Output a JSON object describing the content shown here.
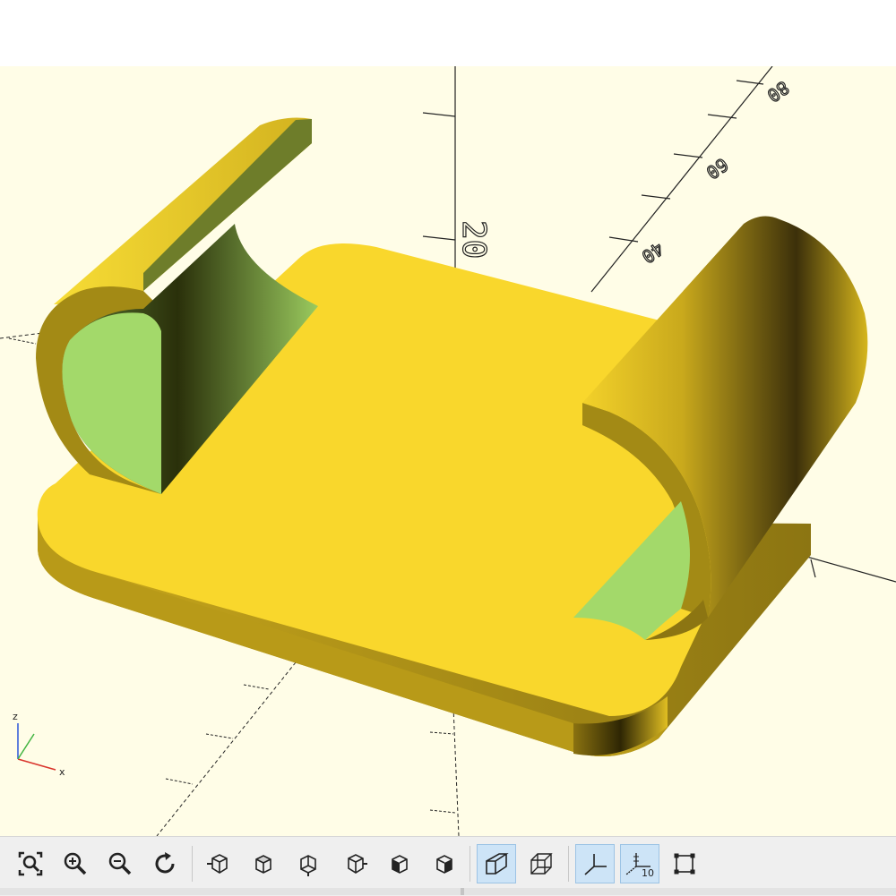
{
  "viewport": {
    "background_color": "#fffde7",
    "model_color": "#f9d72c",
    "inner_face_color": "#a3d96a",
    "axis_labels": {
      "z_tick": "20",
      "y_tick_near": "40",
      "y_tick_mid": "60",
      "y_tick_far": "80"
    },
    "orientation_gizmo": {
      "x": "x",
      "z": "z"
    }
  },
  "toolbar": {
    "buttons": [
      {
        "name": "view-all",
        "icon": "zoom-fit-icon",
        "active": false
      },
      {
        "name": "zoom-in",
        "icon": "zoom-in-icon",
        "active": false
      },
      {
        "name": "zoom-out",
        "icon": "zoom-out-icon",
        "active": false
      },
      {
        "name": "reset-view",
        "icon": "reset-view-icon",
        "active": false
      },
      {
        "name": "view-right",
        "icon": "view-right-icon",
        "active": false
      },
      {
        "name": "view-top",
        "icon": "view-top-icon",
        "active": false
      },
      {
        "name": "view-bottom",
        "icon": "view-bottom-icon",
        "active": false
      },
      {
        "name": "view-left",
        "icon": "view-left-icon",
        "active": false
      },
      {
        "name": "view-front",
        "icon": "view-front-icon",
        "active": false
      },
      {
        "name": "view-back",
        "icon": "view-back-icon",
        "active": false
      },
      {
        "name": "perspective",
        "icon": "perspective-icon",
        "active": true
      },
      {
        "name": "orthogonal",
        "icon": "orthogonal-icon",
        "active": false
      },
      {
        "name": "show-axes",
        "icon": "axes-icon",
        "active": true
      },
      {
        "name": "show-scale-markers",
        "icon": "scale-markers-icon",
        "active": true,
        "label": "10"
      },
      {
        "name": "show-edges",
        "icon": "edges-icon",
        "active": false
      }
    ]
  }
}
